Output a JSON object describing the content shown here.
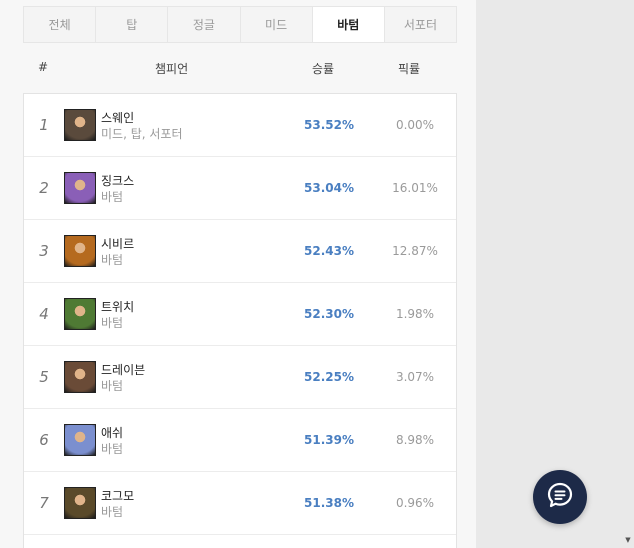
{
  "tabs": [
    {
      "label": "전체",
      "active": false
    },
    {
      "label": "탑",
      "active": false
    },
    {
      "label": "정글",
      "active": false
    },
    {
      "label": "미드",
      "active": false
    },
    {
      "label": "바텀",
      "active": true
    },
    {
      "label": "서포터",
      "active": false
    }
  ],
  "table_header": {
    "rank": "#",
    "champion": "챔피언",
    "win_rate": "승률",
    "pick_rate": "픽률"
  },
  "rows": [
    {
      "rank": "1",
      "name": "스웨인",
      "positions": "미드, 탑, 서포터",
      "win_rate": "53.52%",
      "pick_rate": "0.00%",
      "portrait_color": "#5a4a3c"
    },
    {
      "rank": "2",
      "name": "징크스",
      "positions": "바텀",
      "win_rate": "53.04%",
      "pick_rate": "16.01%",
      "portrait_color": "#8a5fb7"
    },
    {
      "rank": "3",
      "name": "시비르",
      "positions": "바텀",
      "win_rate": "52.43%",
      "pick_rate": "12.87%",
      "portrait_color": "#b56a1f"
    },
    {
      "rank": "4",
      "name": "트위치",
      "positions": "바텀",
      "win_rate": "52.30%",
      "pick_rate": "1.98%",
      "portrait_color": "#4f7a34"
    },
    {
      "rank": "5",
      "name": "드레이븐",
      "positions": "바텀",
      "win_rate": "52.25%",
      "pick_rate": "3.07%",
      "portrait_color": "#6a4b37"
    },
    {
      "rank": "6",
      "name": "애쉬",
      "positions": "바텀",
      "win_rate": "51.39%",
      "pick_rate": "8.98%",
      "portrait_color": "#7b8fcf"
    },
    {
      "rank": "7",
      "name": "코그모",
      "positions": "바텀",
      "win_rate": "51.38%",
      "pick_rate": "0.96%",
      "portrait_color": "#5a4a2a"
    }
  ],
  "colors": {
    "win_rate": "#4a7fc1",
    "chat_button": "#1d2a48"
  },
  "icons": {
    "chat": "chat-bubble-icon"
  }
}
